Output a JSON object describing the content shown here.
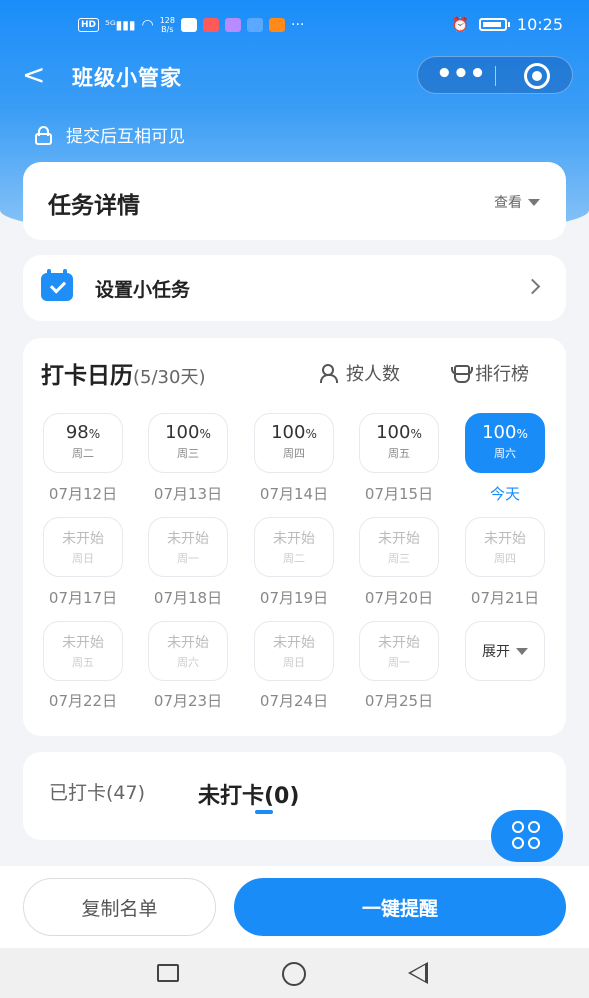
{
  "statusbar": {
    "hd": "HD",
    "net_top": "128",
    "net_bottom": "B/s",
    "app_icons": [
      "wechat-icon",
      "mail-icon",
      "music-icon",
      "alipay-icon",
      "taobao-icon"
    ],
    "more": "···",
    "time": "10:25"
  },
  "navbar": {
    "back_glyph": "<",
    "title": "班级小管家",
    "more_glyph": "•••"
  },
  "notice": {
    "visibility_text": "提交后互相可见"
  },
  "task": {
    "title": "任务详情",
    "view_label": "查看"
  },
  "subtask": {
    "label": "设置小任务"
  },
  "calendar": {
    "title": "打卡日历",
    "count": "(5/30天)",
    "by_people": "按人数",
    "ranking": "排行榜",
    "today_label": "今天",
    "expand_label": "展开",
    "days": [
      {
        "pct": "98",
        "unit": "%",
        "week": "周二",
        "date": "07月12日"
      },
      {
        "pct": "100",
        "unit": "%",
        "week": "周三",
        "date": "07月13日"
      },
      {
        "pct": "100",
        "unit": "%",
        "week": "周四",
        "date": "07月14日"
      },
      {
        "pct": "100",
        "unit": "%",
        "week": "周五",
        "date": "07月15日"
      },
      {
        "pct": "100",
        "unit": "%",
        "week": "周六",
        "date": "今天"
      },
      {
        "pct": "未开始",
        "unit": "",
        "week": "周日",
        "date": "07月17日"
      },
      {
        "pct": "未开始",
        "unit": "",
        "week": "周一",
        "date": "07月18日"
      },
      {
        "pct": "未开始",
        "unit": "",
        "week": "周二",
        "date": "07月19日"
      },
      {
        "pct": "未开始",
        "unit": "",
        "week": "周三",
        "date": "07月20日"
      },
      {
        "pct": "未开始",
        "unit": "",
        "week": "周四",
        "date": "07月21日"
      },
      {
        "pct": "未开始",
        "unit": "",
        "week": "周五",
        "date": "07月22日"
      },
      {
        "pct": "未开始",
        "unit": "",
        "week": "周六",
        "date": "07月23日"
      },
      {
        "pct": "未开始",
        "unit": "",
        "week": "周日",
        "date": "07月24日"
      },
      {
        "pct": "未开始",
        "unit": "",
        "week": "周一",
        "date": "07月25日"
      }
    ]
  },
  "tabs": {
    "done": "已打卡(47)",
    "undone": "未打卡(0)"
  },
  "bottom": {
    "copy": "复制名单",
    "remind": "一键提醒"
  },
  "colors": {
    "accent": "#1a8cf8",
    "background": "#f2f4f7"
  }
}
